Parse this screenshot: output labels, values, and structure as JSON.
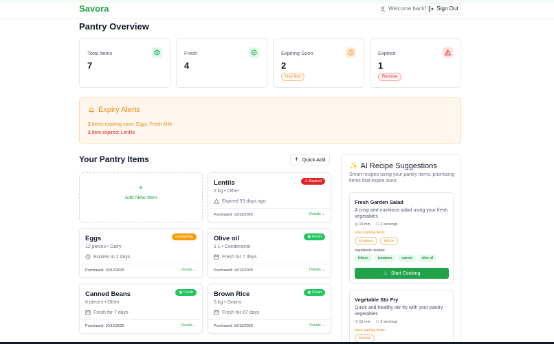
{
  "header": {
    "logo": "Savora",
    "welcome": "Welcome back!",
    "sign_out": "Sign Out"
  },
  "overview": {
    "title": "Pantry Overview",
    "stats": [
      {
        "label": "Total Items",
        "value": "7",
        "icon": "box-icon",
        "color": "#22a34a",
        "bg": "#dcfce7"
      },
      {
        "label": "Fresh",
        "value": "4",
        "icon": "check-circle-icon",
        "color": "#22a34a",
        "bg": "#dcfce7"
      },
      {
        "label": "Expiring Soon",
        "value": "2",
        "icon": "clock-icon",
        "color": "#ea8a1a",
        "bg": "#ffedd5",
        "pill": "Use first"
      },
      {
        "label": "Expired",
        "value": "1",
        "icon": "warning-icon",
        "color": "#dc2626",
        "bg": "#fee2e2",
        "pill": "Remove"
      }
    ]
  },
  "alerts": {
    "title": "Expiry Alerts",
    "expiring_count": "2",
    "expiring_text": "items expiring soon: Eggs, Fresh Milk",
    "expired_count": "1",
    "expired_text": "item expired: Lentils"
  },
  "pantry": {
    "title": "Your Pantry Items",
    "quick_add": "Quick Add",
    "add_new": "Add New Item",
    "items": [
      {
        "name": "Lentils",
        "badge": "Expired",
        "badge_color": "#dc2626",
        "qty": "2 kg • Other",
        "status": "Expired 53 days ago",
        "purchased": "Purchased: 10/12/2025",
        "details": "Details"
      },
      {
        "name": "Eggs",
        "badge": "Expiring",
        "badge_color": "#f59e0b",
        "qty": "12 pieces • Dairy",
        "status": "Expires in 2 days",
        "purchased": "Purchased: 10/12/2025",
        "details": "Details"
      },
      {
        "name": "Olive oil",
        "badge": "Fresh",
        "badge_color": "#22c55e",
        "qty": "1 L • Condiments",
        "status": "Fresh for 7 days",
        "purchased": "Purchased: 10/12/2025",
        "details": "Details"
      },
      {
        "name": "Canned Beans",
        "badge": "Fresh",
        "badge_color": "#22c55e",
        "qty": "6 pieces • Other",
        "status": "Fresh for 7 days",
        "purchased": "Purchased: 10/12/2025",
        "details": "Details"
      },
      {
        "name": "Brown Rice",
        "badge": "Fresh",
        "badge_color": "#22c55e",
        "qty": "5 kg • Grains",
        "status": "Fresh for 87 days",
        "purchased": "Purchased: 10/12/2025",
        "details": "Details"
      }
    ]
  },
  "ai": {
    "title": "AI Recipe Suggestions",
    "subtitle": "Smart recipes using your pantry items, prioritizing items that expire soon",
    "recipes": [
      {
        "name": "Fresh Garden Salad",
        "desc": "A crisp and nutritious salad using your fresh vegetables",
        "time": "10 min",
        "servings": "2 servings",
        "uses_label": "Uses expiring items:",
        "uses": [
          "tomatoes",
          "lettuce"
        ],
        "ing_label": "Ingredients needed:",
        "ingredients": [
          "lettuce",
          "tomatoes",
          "carrots",
          "olive oil"
        ],
        "button": "Start Cooking"
      },
      {
        "name": "Vegetable Stir Fry",
        "desc": "Quick and healthy stir fry with your pantry vegetables",
        "time": "15 min",
        "servings": "3 servings",
        "uses_label": "Uses expiring items:",
        "uses": [
          "broccoli"
        ]
      }
    ]
  }
}
